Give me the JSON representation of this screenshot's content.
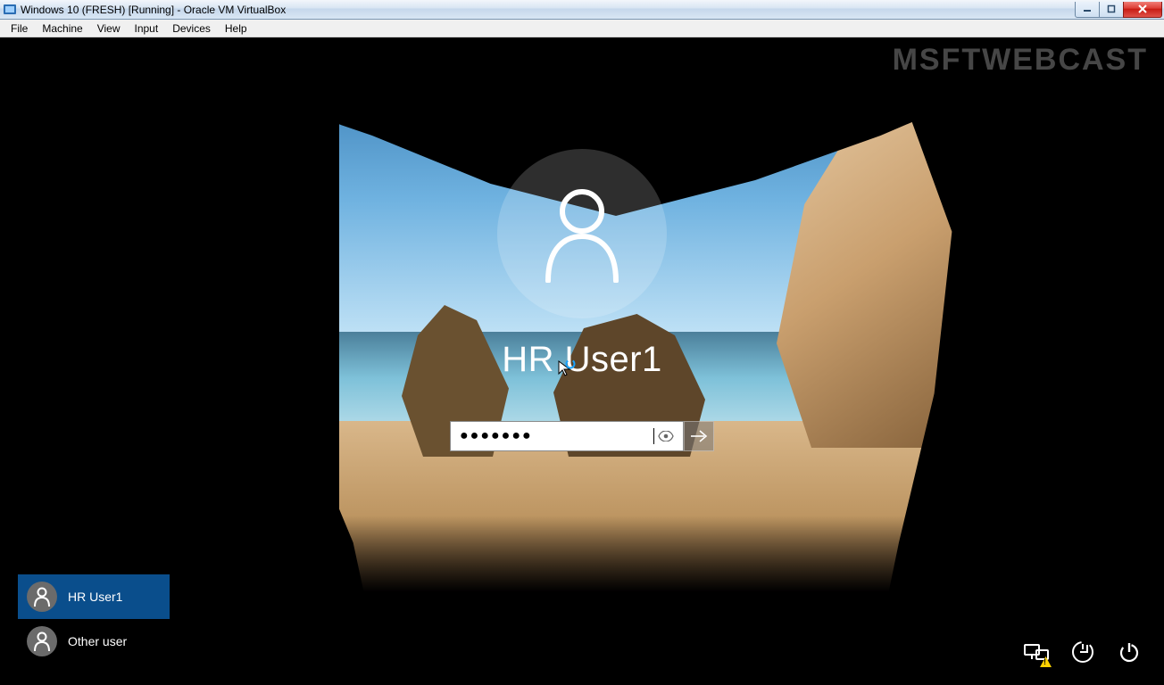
{
  "host_window": {
    "title": "Windows 10 (FRESH) [Running] - Oracle VM VirtualBox",
    "menu": {
      "file": "File",
      "machine": "Machine",
      "view": "View",
      "input": "Input",
      "devices": "Devices",
      "help": "Help"
    },
    "buttons": {
      "minimize": "_",
      "maximize": "▭",
      "close": "✕"
    }
  },
  "watermark": "MSFTWEBCAST",
  "login": {
    "username": "HR User1",
    "password_mask": "●●●●●●●",
    "reveal_icon": "eye-icon",
    "submit_icon": "arrow-right-icon"
  },
  "users": [
    {
      "label": "HR User1",
      "selected": true
    },
    {
      "label": "Other user",
      "selected": false
    }
  ],
  "tray": {
    "network_icon": "network-icon",
    "ease_icon": "ease-of-access-icon",
    "power_icon": "power-icon",
    "network_warning": true
  }
}
